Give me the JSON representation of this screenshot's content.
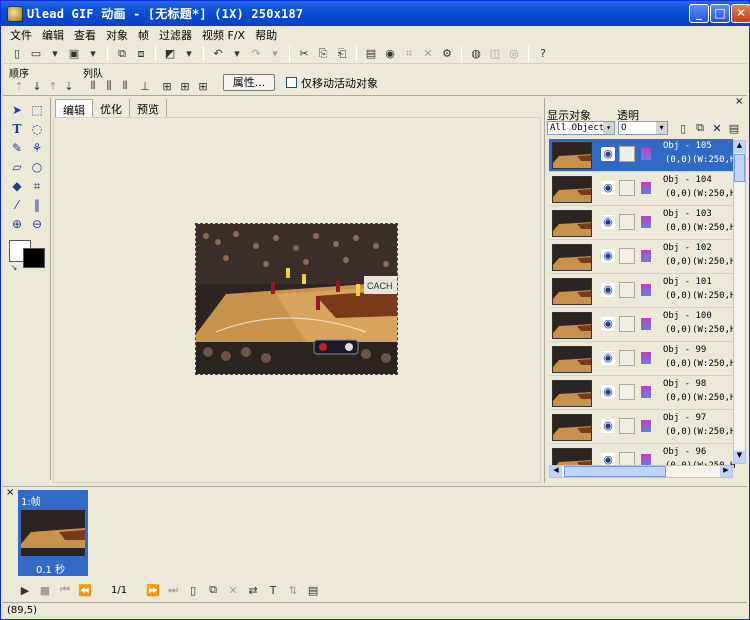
{
  "window": {
    "title": "Ulead GIF 动画 - [无标题*] (1X) 250x187",
    "min_glyph": "_",
    "max_glyph": "□",
    "close_glyph": "✕"
  },
  "menu": [
    "文件",
    "编辑",
    "查看",
    "对象",
    "帧",
    "过滤器",
    "视频 F/X",
    "帮助"
  ],
  "toolbar2": {
    "order_label": "顺序",
    "queue_label": "列队",
    "attr_button": "属性...",
    "only_move_active_label": "仅移动活动对象"
  },
  "tabs": [
    "编辑",
    "优化",
    "预览"
  ],
  "object_panel": {
    "show_objects_label": "显示对象",
    "opacity_label": "透明",
    "filter_value": "All Object:",
    "opacity_value": "0",
    "objects": [
      {
        "name": "Obj - 105",
        "pos": "(0,0)(W:250,H:",
        "selected": true
      },
      {
        "name": "Obj - 104",
        "pos": "(0,0)(W:250,H:",
        "selected": false
      },
      {
        "name": "Obj - 103",
        "pos": "(0,0)(W:250,H:",
        "selected": false
      },
      {
        "name": "Obj - 102",
        "pos": "(0,0)(W:250,H:",
        "selected": false
      },
      {
        "name": "Obj - 101",
        "pos": "(0,0)(W:250,H:",
        "selected": false
      },
      {
        "name": "Obj - 100",
        "pos": "(0,0)(W:250,H:",
        "selected": false
      },
      {
        "name": "Obj - 99",
        "pos": "(0,0)(W:250,H:",
        "selected": false
      },
      {
        "name": "Obj - 98",
        "pos": "(0,0)(W:250,H:",
        "selected": false
      },
      {
        "name": "Obj - 97",
        "pos": "(0,0)(W:250,H:",
        "selected": false
      },
      {
        "name": "Obj - 96",
        "pos": "(0,0)(W:250,H:",
        "selected": false
      }
    ]
  },
  "frame_panel": {
    "frame_label": "1:帧",
    "frame_time": "0.1 秒",
    "frame_counter": "1/1"
  },
  "status": {
    "coords": "(89,5)"
  },
  "colors": {
    "title_blue": "#0a4fd6",
    "selection": "#316ac5",
    "chrome": "#ece9d8"
  }
}
